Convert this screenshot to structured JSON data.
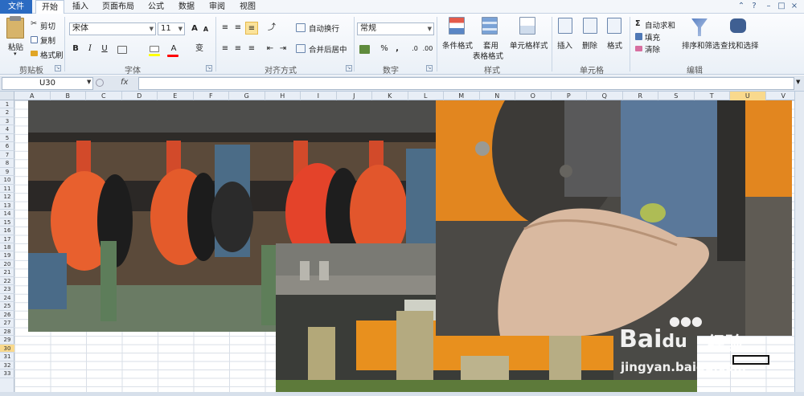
{
  "tabs": {
    "file": "文件",
    "items": [
      "开始",
      "插入",
      "页面布局",
      "公式",
      "数据",
      "审阅",
      "视图"
    ],
    "active_index": 0
  },
  "window_buttons": [
    "?",
    "⌃",
    "–",
    "□",
    "×"
  ],
  "ribbon": {
    "clipboard": {
      "paste": "粘贴",
      "cut": "剪切",
      "copy": "复制",
      "format_painter": "格式刷",
      "group": "剪贴板"
    },
    "font": {
      "name": "宋体",
      "size": "11",
      "bold": "B",
      "italic": "I",
      "underline": "U",
      "fill_color": "#ffff00",
      "font_color": "#ff0000",
      "wen": "变",
      "group": "字体"
    },
    "alignment": {
      "wrap": "自动换行",
      "merge": "合并后居中",
      "group": "对齐方式"
    },
    "number": {
      "format": "常规",
      "percent": "%",
      "comma": ",",
      "group": "数字"
    },
    "styles": {
      "conditional": "条件格式",
      "table_line1": "套用",
      "table_line2": "表格格式",
      "cell_styles": "单元格样式",
      "group": "样式"
    },
    "cells": {
      "insert": "插入",
      "delete": "删除",
      "format": "格式",
      "group": "单元格"
    },
    "editing": {
      "autosum": "自动求和",
      "fill": "填充",
      "clear": "清除",
      "sort": "排序和筛选",
      "find": "查找和选择",
      "group": "编辑"
    }
  },
  "formula_bar": {
    "name_box": "U30",
    "fx": "fx",
    "value": ""
  },
  "columns": [
    "A",
    "B",
    "C",
    "D",
    "E",
    "F",
    "G",
    "H",
    "I",
    "J",
    "K",
    "L",
    "M",
    "N",
    "O",
    "P",
    "Q",
    "R",
    "S",
    "T",
    "U",
    "V"
  ],
  "selected_column": "U",
  "rows": [
    "1",
    "2",
    "3",
    "4",
    "5",
    "6",
    "7",
    "8",
    "9",
    "10",
    "11",
    "12",
    "13",
    "14",
    "15",
    "16",
    "17",
    "18",
    "19",
    "20",
    "21",
    "22",
    "23",
    "24",
    "25",
    "26",
    "27",
    "28",
    "29",
    "30",
    "31",
    "32",
    "33"
  ],
  "selected_row": "30",
  "watermark": {
    "brand": "Bai",
    "brand2": "经验",
    "url": "jingyan.baidu.com"
  }
}
